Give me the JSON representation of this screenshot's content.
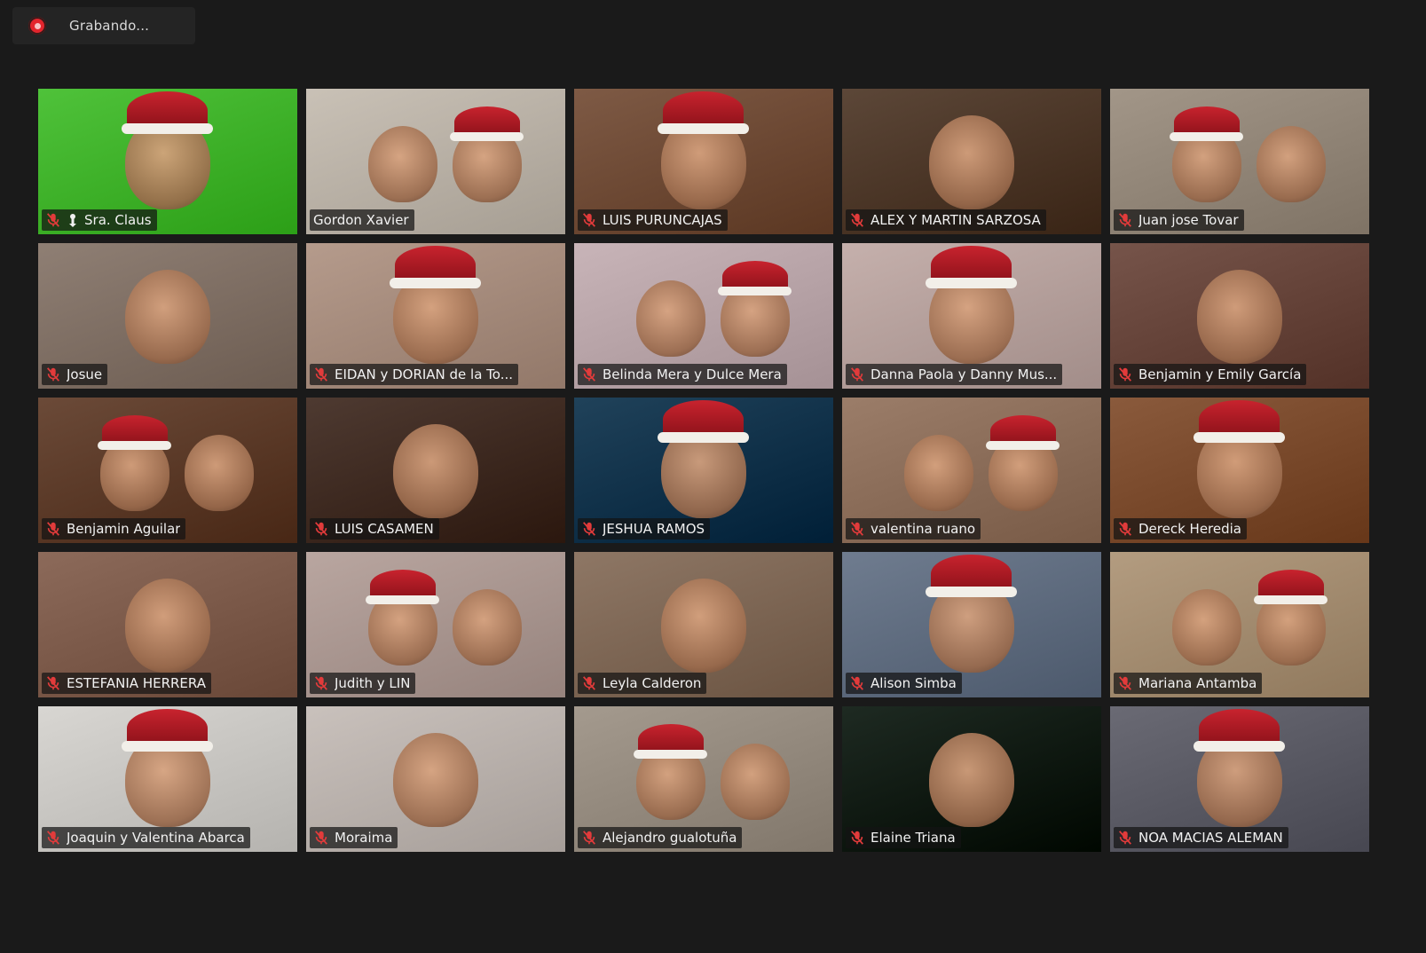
{
  "recording": {
    "label": "Grabando...",
    "icon": "record-icon",
    "color": "#e3252d"
  },
  "gallery": {
    "active_color": "#e6e63a",
    "muted_icon": "mic-muted-icon",
    "participants": [
      {
        "name": "Sra. Claus",
        "muted": true,
        "pinned": true,
        "active": true,
        "bg": "#4fc23a"
      },
      {
        "name": "Gordon Xavier",
        "muted": false,
        "bg": "#c9c1b6"
      },
      {
        "name": "LUIS PURUNCAJAS",
        "muted": true,
        "bg": "#7e5a45"
      },
      {
        "name": "ALEX Y MARTIN SARZOSA",
        "muted": true,
        "bg": "#5c4738"
      },
      {
        "name": "Juan jose Tovar",
        "muted": true,
        "bg": "#a29688"
      },
      {
        "name": "Josue",
        "muted": true,
        "bg": "#8f7f74"
      },
      {
        "name": "EIDAN y DORIAN  de la To...",
        "muted": true,
        "bg": "#b59b8c"
      },
      {
        "name": "Belinda Mera y Dulce Mera",
        "muted": true,
        "bg": "#c8b4b8"
      },
      {
        "name": "Danna Paola y Danny Mus...",
        "muted": true,
        "bg": "#c5b0ac"
      },
      {
        "name": "Benjamin y Emily García",
        "muted": true,
        "bg": "#76544a"
      },
      {
        "name": "Benjamin Aguilar",
        "muted": true,
        "bg": "#6b4a38"
      },
      {
        "name": "LUIS CASAMEN",
        "muted": true,
        "bg": "#4e3a31"
      },
      {
        "name": "JESHUA RAMOS",
        "muted": true,
        "bg": "#20425a"
      },
      {
        "name": "valentina  ruano",
        "muted": true,
        "bg": "#9b7d69"
      },
      {
        "name": "Dereck Heredia",
        "muted": true,
        "bg": "#8a5a3c"
      },
      {
        "name": "ESTEFANIA HERRERA",
        "muted": true,
        "bg": "#8c6a5a"
      },
      {
        "name": "Judith  y LIN",
        "muted": true,
        "bg": "#b9a6a0"
      },
      {
        "name": "Leyla Calderon",
        "muted": true,
        "bg": "#8e7765"
      },
      {
        "name": "Alison Simba",
        "muted": true,
        "bg": "#6f7c8f"
      },
      {
        "name": "Mariana Antamba",
        "muted": true,
        "bg": "#b39c80"
      },
      {
        "name": "Joaquin y Valentina Abarca",
        "muted": true,
        "bg": "#d8d6d2"
      },
      {
        "name": "Moraima",
        "muted": true,
        "bg": "#c9c1bc"
      },
      {
        "name": "Alejandro gualotuña",
        "muted": true,
        "bg": "#a49a8e"
      },
      {
        "name": "Elaine Triana",
        "muted": true,
        "bg": "#1e2a22"
      },
      {
        "name": "NOA MACIAS ALEMAN",
        "muted": true,
        "bg": "#6a6a74"
      }
    ]
  }
}
